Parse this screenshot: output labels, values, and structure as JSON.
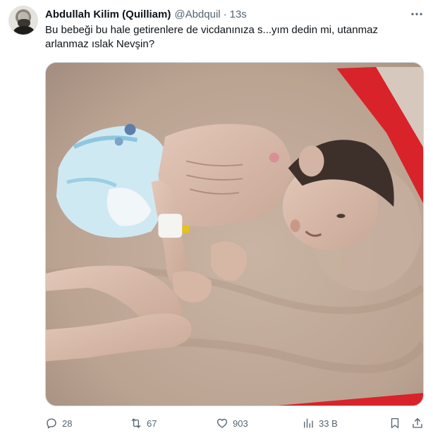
{
  "author": {
    "name": "Abdullah Kilim (Quilliam)",
    "handle": "@Abdquil",
    "separator": "·",
    "time": "13s"
  },
  "tweet": {
    "text": "Bu bebeği bu hale getirenlere de vicdanınıza s...yım dedin mi, utanmaz arlanmaz ıslak Nevşin?"
  },
  "actions": {
    "replies": "28",
    "retweets": "67",
    "likes": "903",
    "views": "33 B"
  },
  "icons": {
    "more": "more-horizontal-icon",
    "reply": "reply-icon",
    "retweet": "retweet-icon",
    "like": "heart-icon",
    "views": "views-bar-chart-icon",
    "bookmark": "bookmark-icon",
    "share": "share-icon"
  },
  "colors": {
    "text_primary": "#0f1419",
    "text_secondary": "#536471",
    "border": "#cfd9de",
    "blanket": "#c4ad9c",
    "blanket_trim": "#d8232a"
  }
}
